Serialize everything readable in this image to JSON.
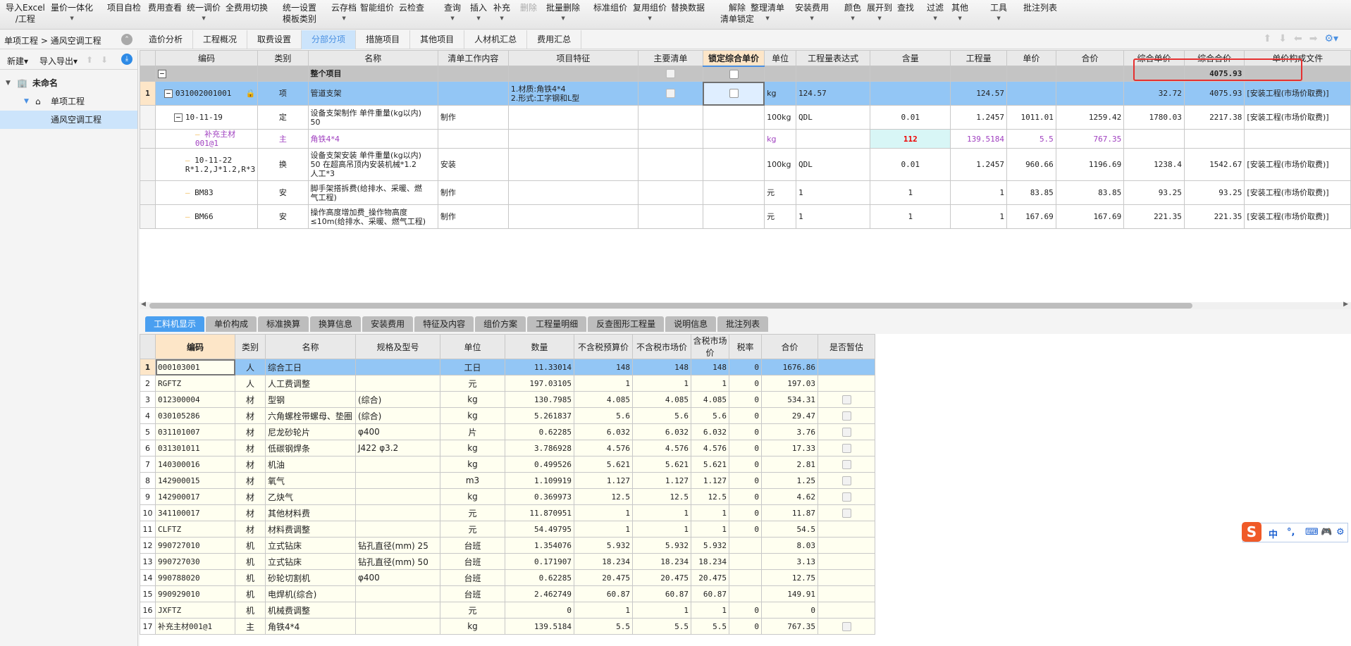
{
  "toolbar": {
    "buttons": [
      {
        "label": "导入Excel",
        "label2": "/工程",
        "dropdown": true
      },
      {
        "label": "量价一体化",
        "dropdown": true
      },
      {
        "label": "项目自检"
      },
      {
        "label": "费用查看"
      },
      {
        "label": "统一调价",
        "dropdown": true
      },
      {
        "label": "全费用切换"
      },
      {
        "label": "统一设置",
        "label2": "模板类别"
      },
      {
        "label": "云存档",
        "dropdown": true
      },
      {
        "label": "智能组价"
      },
      {
        "label": "云检查"
      },
      {
        "label": "查询",
        "dropdown": true
      },
      {
        "label": "插入",
        "dropdown": true
      },
      {
        "label": "补充",
        "dropdown": true
      },
      {
        "label": "删除",
        "disabled": true
      },
      {
        "label": "批量删除",
        "dropdown": true
      },
      {
        "label": "标准组价"
      },
      {
        "label": "复用组价",
        "dropdown": true
      },
      {
        "label": "替换数据"
      },
      {
        "label": "解除",
        "label2": "清单锁定"
      },
      {
        "label": "整理清单",
        "dropdown": true
      },
      {
        "label": "安装费用",
        "dropdown": true
      },
      {
        "label": "颜色",
        "dropdown": true
      },
      {
        "label": "展开到",
        "dropdown": true
      },
      {
        "label": "查找"
      },
      {
        "label": "过滤",
        "dropdown": true
      },
      {
        "label": "其他",
        "dropdown": true
      },
      {
        "label": "工具",
        "dropdown": true
      },
      {
        "label": "批注列表"
      }
    ]
  },
  "breadcrumb": "单项工程 > 通风空调工程",
  "tabs": [
    "造价分析",
    "工程概况",
    "取费设置",
    "分部分项",
    "措施项目",
    "其他项目",
    "人材机汇总",
    "费用汇总"
  ],
  "active_tab": "分部分项",
  "sidebar": {
    "new_label": "新建",
    "import_export_label": "导入导出",
    "tree": [
      {
        "label": "未命名",
        "level": 0
      },
      {
        "label": "单项工程",
        "level": 1
      },
      {
        "label": "通风空调工程",
        "level": 2,
        "selected": true
      }
    ]
  },
  "main_grid": {
    "columns": [
      "编码",
      "类别",
      "名称",
      "清单工作内容",
      "项目特征",
      "主要清单",
      "锁定综合单价",
      "单位",
      "工程量表达式",
      "含量",
      "工程量",
      "单价",
      "合价",
      "综合单价",
      "综合合价",
      "单价构成文件"
    ],
    "group_row": {
      "name": "整个项目",
      "total": "4075.93"
    },
    "rows": [
      {
        "num": "1",
        "code": "031002001001",
        "type": "项",
        "name": "管道支架",
        "work": "",
        "feature": "1.材质:角铁4*4\n2.形式:工字钢和L型",
        "unit": "kg",
        "expr": "124.57",
        "content": "",
        "qty": "124.57",
        "price": "",
        "sum": "",
        "uprice": "32.72",
        "usum": "4075.93",
        "file": "[安装工程(市场价取费)]"
      },
      {
        "num": "",
        "code": "10-11-19",
        "type": "定",
        "name": "设备支架制作 单件重量(kg以内)\n50",
        "work": "制作",
        "feature": "",
        "unit": "100kg",
        "expr": "QDL",
        "content": "0.01",
        "qty": "1.2457",
        "price": "1011.01",
        "sum": "1259.42",
        "uprice": "1780.03",
        "usum": "2217.38",
        "file": "[安装工程(市场价取费)]"
      },
      {
        "num": "",
        "code": "补充主材001@1",
        "type": "主",
        "name": "角铁4*4",
        "work": "",
        "feature": "",
        "unit": "kg",
        "expr": "",
        "content": "112",
        "qty": "139.5184",
        "price": "5.5",
        "sum": "767.35",
        "uprice": "",
        "usum": "",
        "file": ""
      },
      {
        "num": "",
        "code": "10-11-22\nR*1.2,J*1.2,R*3",
        "type": "换",
        "name": "设备支架安装 单件重量(kg以内)\n50  在超高吊顶内安装机械*1.2\n人工*3",
        "work": "安装",
        "feature": "",
        "unit": "100kg",
        "expr": "QDL",
        "content": "0.01",
        "qty": "1.2457",
        "price": "960.66",
        "sum": "1196.69",
        "uprice": "1238.4",
        "usum": "1542.67",
        "file": "[安装工程(市场价取费)]"
      },
      {
        "num": "",
        "code": "BM83",
        "type": "安",
        "name": "脚手架搭拆费(给排水、采暖、燃\n气工程)",
        "work": "制作",
        "feature": "",
        "unit": "元",
        "expr": "1",
        "content": "1",
        "qty": "1",
        "price": "83.85",
        "sum": "83.85",
        "uprice": "93.25",
        "usum": "93.25",
        "file": "[安装工程(市场价取费)]"
      },
      {
        "num": "",
        "code": "BM66",
        "type": "安",
        "name": "操作高度增加费_操作物高度\n≤10m(给排水、采暖、燃气工程)",
        "work": "制作",
        "feature": "",
        "unit": "元",
        "expr": "1",
        "content": "1",
        "qty": "1",
        "price": "167.69",
        "sum": "167.69",
        "uprice": "221.35",
        "usum": "221.35",
        "file": "[安装工程(市场价取费)]"
      }
    ]
  },
  "bottom_tabs": [
    "工料机显示",
    "单价构成",
    "标准换算",
    "换算信息",
    "安装费用",
    "特征及内容",
    "组价方案",
    "工程量明细",
    "反查图形工程量",
    "说明信息",
    "批注列表"
  ],
  "active_bottom_tab": "工料机显示",
  "bottom_grid": {
    "columns": [
      "编码",
      "类别",
      "名称",
      "规格及型号",
      "单位",
      "数量",
      "不含税预算价",
      "不含税市场价",
      "含税市场价",
      "税率",
      "合价",
      "是否暂估"
    ],
    "rows": [
      {
        "num": "1",
        "code": "000103001",
        "type": "人",
        "name": "综合工日",
        "spec": "",
        "unit": "工日",
        "qty": "11.33014",
        "p1": "148",
        "p2": "148",
        "p3": "148",
        "tax": "0",
        "sum": "1676.86",
        "est": false
      },
      {
        "num": "2",
        "code": "RGFTZ",
        "type": "人",
        "name": "人工费调整",
        "spec": "",
        "unit": "元",
        "qty": "197.03105",
        "p1": "1",
        "p2": "1",
        "p3": "1",
        "tax": "0",
        "sum": "197.03",
        "est": false
      },
      {
        "num": "3",
        "code": "012300004",
        "type": "材",
        "name": "型钢",
        "spec": "(综合)",
        "unit": "kg",
        "qty": "130.7985",
        "p1": "4.085",
        "p2": "4.085",
        "p3": "4.085",
        "tax": "0",
        "sum": "534.31",
        "est": true
      },
      {
        "num": "4",
        "code": "030105286",
        "type": "材",
        "name": "六角螺栓带螺母、垫圈",
        "spec": "(综合)",
        "unit": "kg",
        "qty": "5.261837",
        "p1": "5.6",
        "p2": "5.6",
        "p3": "5.6",
        "tax": "0",
        "sum": "29.47",
        "est": true
      },
      {
        "num": "5",
        "code": "031101007",
        "type": "材",
        "name": "尼龙砂轮片",
        "spec": "φ400",
        "unit": "片",
        "qty": "0.62285",
        "p1": "6.032",
        "p2": "6.032",
        "p3": "6.032",
        "tax": "0",
        "sum": "3.76",
        "est": true
      },
      {
        "num": "6",
        "code": "031301011",
        "type": "材",
        "name": "低碳钢焊条",
        "spec": "J422 φ3.2",
        "unit": "kg",
        "qty": "3.786928",
        "p1": "4.576",
        "p2": "4.576",
        "p3": "4.576",
        "tax": "0",
        "sum": "17.33",
        "est": true
      },
      {
        "num": "7",
        "code": "140300016",
        "type": "材",
        "name": "机油",
        "spec": "",
        "unit": "kg",
        "qty": "0.499526",
        "p1": "5.621",
        "p2": "5.621",
        "p3": "5.621",
        "tax": "0",
        "sum": "2.81",
        "est": true
      },
      {
        "num": "8",
        "code": "142900015",
        "type": "材",
        "name": "氧气",
        "spec": "",
        "unit": "m3",
        "qty": "1.109919",
        "p1": "1.127",
        "p2": "1.127",
        "p3": "1.127",
        "tax": "0",
        "sum": "1.25",
        "est": true
      },
      {
        "num": "9",
        "code": "142900017",
        "type": "材",
        "name": "乙炔气",
        "spec": "",
        "unit": "kg",
        "qty": "0.369973",
        "p1": "12.5",
        "p2": "12.5",
        "p3": "12.5",
        "tax": "0",
        "sum": "4.62",
        "est": true
      },
      {
        "num": "10",
        "code": "341100017",
        "type": "材",
        "name": "其他材料费",
        "spec": "",
        "unit": "元",
        "qty": "11.870951",
        "p1": "1",
        "p2": "1",
        "p3": "1",
        "tax": "0",
        "sum": "11.87",
        "est": true
      },
      {
        "num": "11",
        "code": "CLFTZ",
        "type": "材",
        "name": "材料费调整",
        "spec": "",
        "unit": "元",
        "qty": "54.49795",
        "p1": "1",
        "p2": "1",
        "p3": "1",
        "tax": "0",
        "sum": "54.5",
        "est": false
      },
      {
        "num": "12",
        "code": "990727010",
        "type": "机",
        "name": "立式钻床",
        "spec": "钻孔直径(mm) 25",
        "unit": "台班",
        "qty": "1.354076",
        "p1": "5.932",
        "p2": "5.932",
        "p3": "5.932",
        "tax": "",
        "sum": "8.03",
        "est": false
      },
      {
        "num": "13",
        "code": "990727030",
        "type": "机",
        "name": "立式钻床",
        "spec": "钻孔直径(mm) 50",
        "unit": "台班",
        "qty": "0.171907",
        "p1": "18.234",
        "p2": "18.234",
        "p3": "18.234",
        "tax": "",
        "sum": "3.13",
        "est": false
      },
      {
        "num": "14",
        "code": "990788020",
        "type": "机",
        "name": "砂轮切割机",
        "spec": "φ400",
        "unit": "台班",
        "qty": "0.62285",
        "p1": "20.475",
        "p2": "20.475",
        "p3": "20.475",
        "tax": "",
        "sum": "12.75",
        "est": false
      },
      {
        "num": "15",
        "code": "990929010",
        "type": "机",
        "name": "电焊机(综合)",
        "spec": "",
        "unit": "台班",
        "qty": "2.462749",
        "p1": "60.87",
        "p2": "60.87",
        "p3": "60.87",
        "tax": "",
        "sum": "149.91",
        "est": false
      },
      {
        "num": "16",
        "code": "JXFTZ",
        "type": "机",
        "name": "机械费调整",
        "spec": "",
        "unit": "元",
        "qty": "0",
        "p1": "1",
        "p2": "1",
        "p3": "1",
        "tax": "0",
        "sum": "0",
        "est": false
      },
      {
        "num": "17",
        "code": "补充主材001@1",
        "type": "主",
        "name": "角铁4*4",
        "spec": "",
        "unit": "kg",
        "qty": "139.5184",
        "p1": "5.5",
        "p2": "5.5",
        "p3": "5.5",
        "tax": "0",
        "sum": "767.35",
        "est": true
      }
    ]
  },
  "ime": {
    "logo": "S",
    "items": [
      "中",
      "°,",
      "键盘",
      "游戏",
      "设置"
    ]
  },
  "colors": {
    "accent": "#4a90e2",
    "selected_row": "#93c6f5",
    "main_material": "#a040c0",
    "highlight_box": "#e53030"
  }
}
